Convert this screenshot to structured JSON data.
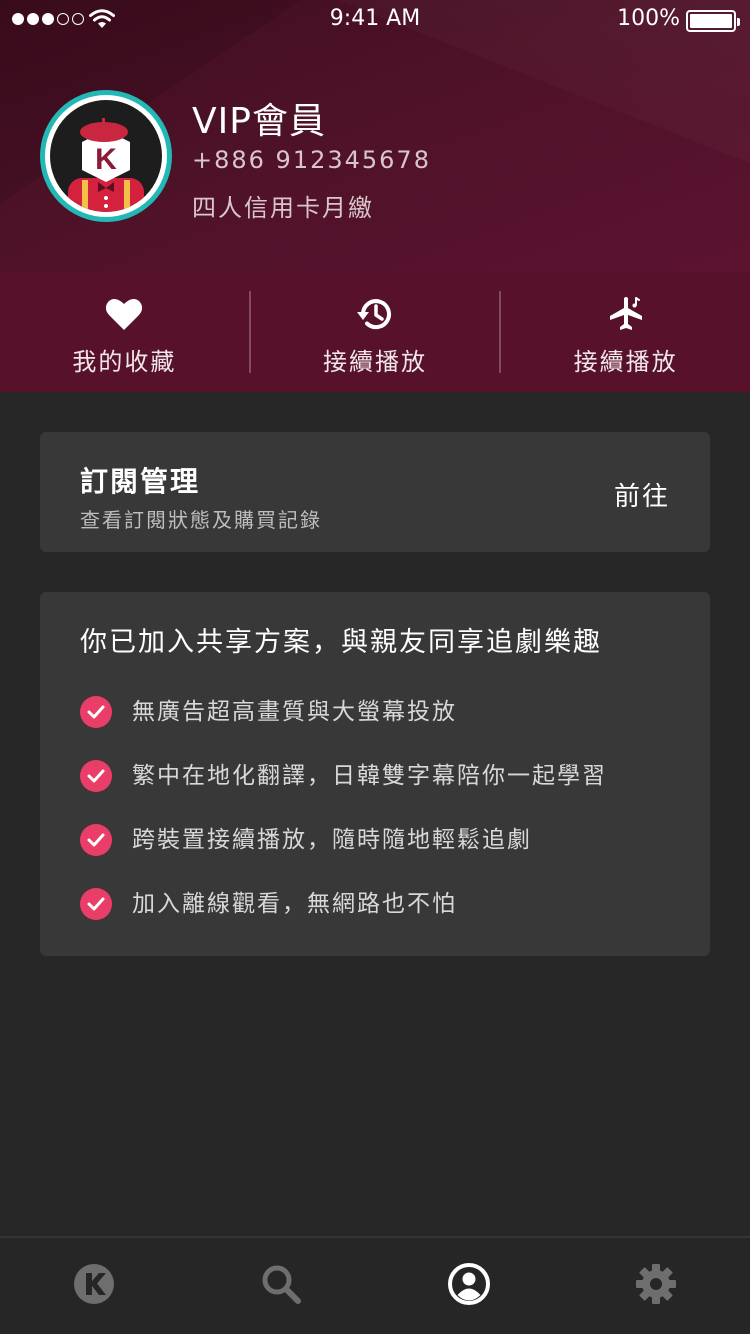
{
  "status_bar": {
    "time": "9:41 AM",
    "battery_percent": "100%",
    "signal_bars_on": 3,
    "signal_bars_total": 5
  },
  "profile": {
    "name": "VIP會員",
    "phone": "+886 912345678",
    "plan": "四人信用卡月繳",
    "avatar_icon": "kkdrama-mascot-avatar",
    "avatar_letter": "K",
    "ring_color": "#22b8b6"
  },
  "quick_actions": [
    {
      "icon": "heart-icon",
      "label": "我的收藏"
    },
    {
      "icon": "history-icon",
      "label": "接續播放"
    },
    {
      "icon": "airplane-icon",
      "label": "接續播放"
    }
  ],
  "subscription": {
    "title": "訂閱管理",
    "description": "查看訂閱狀態及購買記錄",
    "action": "前往"
  },
  "benefits": {
    "title": "你已加入共享方案，與親友同享追劇樂趣",
    "items": [
      "無廣告超高畫質與大螢幕投放",
      "繁中在地化翻譯，日韓雙字幕陪你一起學習",
      "跨裝置接續播放，隨時隨地輕鬆追劇",
      "加入離線觀看，無網路也不怕"
    ],
    "check_color": "#ea3e68"
  },
  "tab_bar": {
    "tabs": [
      {
        "icon": "home-k-icon",
        "active": false
      },
      {
        "icon": "search-icon",
        "active": false
      },
      {
        "icon": "profile-icon",
        "active": true
      },
      {
        "icon": "settings-gear-icon",
        "active": false
      }
    ],
    "active_color": "#ffffff",
    "inactive_color": "#6e6e6e"
  },
  "colors": {
    "header": "#4e1228",
    "quick_actions_bg": "#57112b",
    "background": "#272727",
    "card": "#383838"
  }
}
